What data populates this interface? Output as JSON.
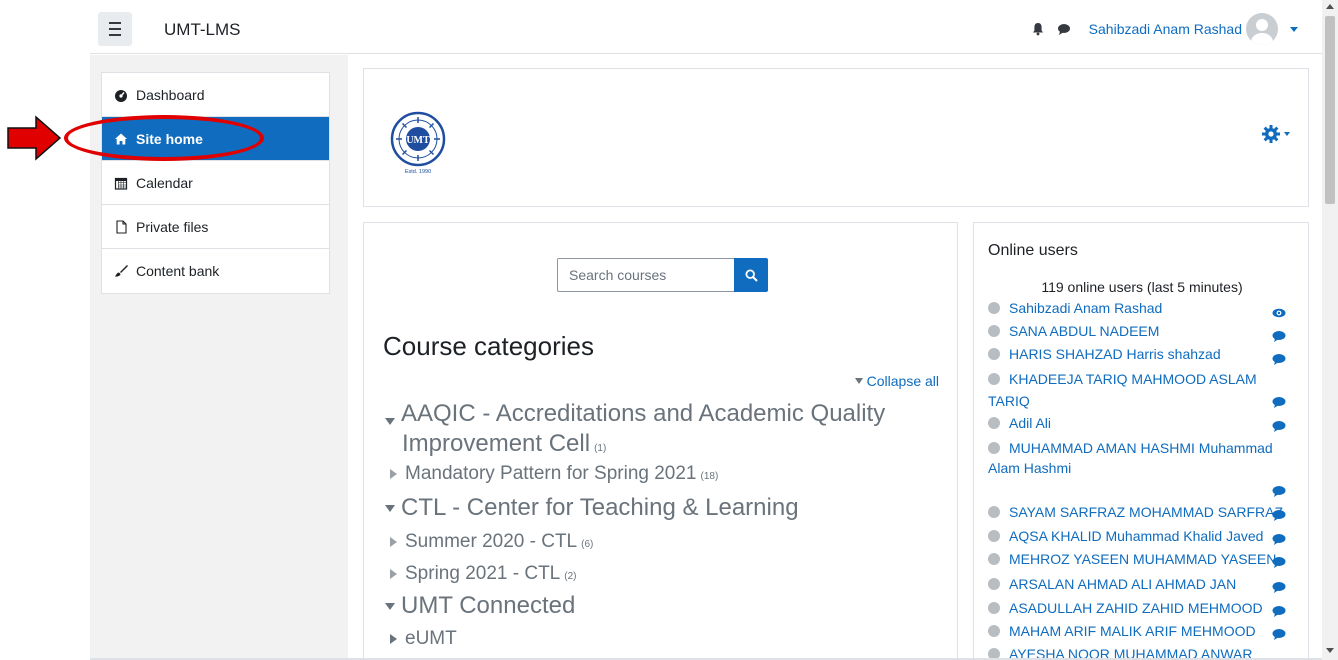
{
  "navbar": {
    "brand": "UMT-LMS",
    "user_name": "Sahibzadi Anam Rashad",
    "icons": [
      "menu-icon",
      "bell-icon",
      "chat-icon",
      "avatar",
      "chevron-down-icon"
    ]
  },
  "sidebar": {
    "items": [
      {
        "label": "Dashboard",
        "icon": "dashboard-icon",
        "active": false
      },
      {
        "label": "Site home",
        "icon": "home-icon",
        "active": true
      },
      {
        "label": "Calendar",
        "icon": "calendar-icon",
        "active": false
      },
      {
        "label": "Private files",
        "icon": "file-icon",
        "active": false
      },
      {
        "label": "Content bank",
        "icon": "brush-icon",
        "active": false
      }
    ]
  },
  "annotation": {
    "arrow_color": "#e00000",
    "ellipse_color": "#e00000"
  },
  "header": {
    "logo_text": "UMT",
    "logo_subtext": "Estd. 1990"
  },
  "search": {
    "placeholder": "Search courses"
  },
  "categories": {
    "title": "Course categories",
    "collapse_label": "Collapse all",
    "items": [
      {
        "name_line1": "AAQIC - Accreditations and Academic Quality",
        "name_line2": "Improvement Cell",
        "count": "(1)",
        "level": 0
      },
      {
        "name": "Mandatory Pattern for Spring 2021",
        "count": "(18)",
        "level": 1
      },
      {
        "name": "CTL - Center for Teaching & Learning",
        "count": "",
        "level": 0
      },
      {
        "name": "Summer 2020 - CTL",
        "count": "(6)",
        "level": 1
      },
      {
        "name": "Spring 2021 - CTL",
        "count": "(2)",
        "level": 1
      },
      {
        "name": "UMT Connected",
        "count": "",
        "level": 0
      },
      {
        "name": "eUMT",
        "count": "",
        "level": 1
      }
    ]
  },
  "online_users": {
    "title": "Online users",
    "count_text": "119 online users (last 5 minutes)",
    "users": [
      {
        "name": "Sahibzadi Anam Rashad",
        "action": "eye-icon"
      },
      {
        "name": "SANA ABDUL NADEEM",
        "action": "chat-icon"
      },
      {
        "name": "HARIS SHAHZAD Harris shahzad",
        "action": "chat-icon"
      },
      {
        "name": "KHADEEJA TARIQ MAHMOOD ASLAM TARIQ",
        "action": "chat-icon"
      },
      {
        "name": "Adil Ali",
        "action": "chat-icon"
      },
      {
        "name_line1": "MUHAMMAD AMAN HASHMI Muhammad",
        "name_line2": "Alam Hashmi",
        "action": "chat-icon"
      },
      {
        "name": "SAYAM SARFRAZ MOHAMMAD SARFRAZ",
        "action": "chat-icon"
      },
      {
        "name": "AQSA KHALID Muhammad Khalid Javed",
        "action": "chat-icon"
      },
      {
        "name": "MEHROZ YASEEN MUHAMMAD YASEEN",
        "action": "chat-icon"
      },
      {
        "name": "ARSALAN AHMAD ALI AHMAD JAN",
        "action": "chat-icon"
      },
      {
        "name": "ASADULLAH ZAHID ZAHID MEHMOOD",
        "action": "chat-icon"
      },
      {
        "name": "MAHAM ARIF MALIK ARIF MEHMOOD",
        "action": "chat-icon"
      },
      {
        "name": "AYESHA NOOR MUHAMMAD ANWAR KHAN",
        "action": "chat-icon"
      }
    ]
  },
  "colors": {
    "accent": "#0f6cbf",
    "drawer_bg": "#f2f2f2",
    "muted_text": "#6a737b"
  }
}
